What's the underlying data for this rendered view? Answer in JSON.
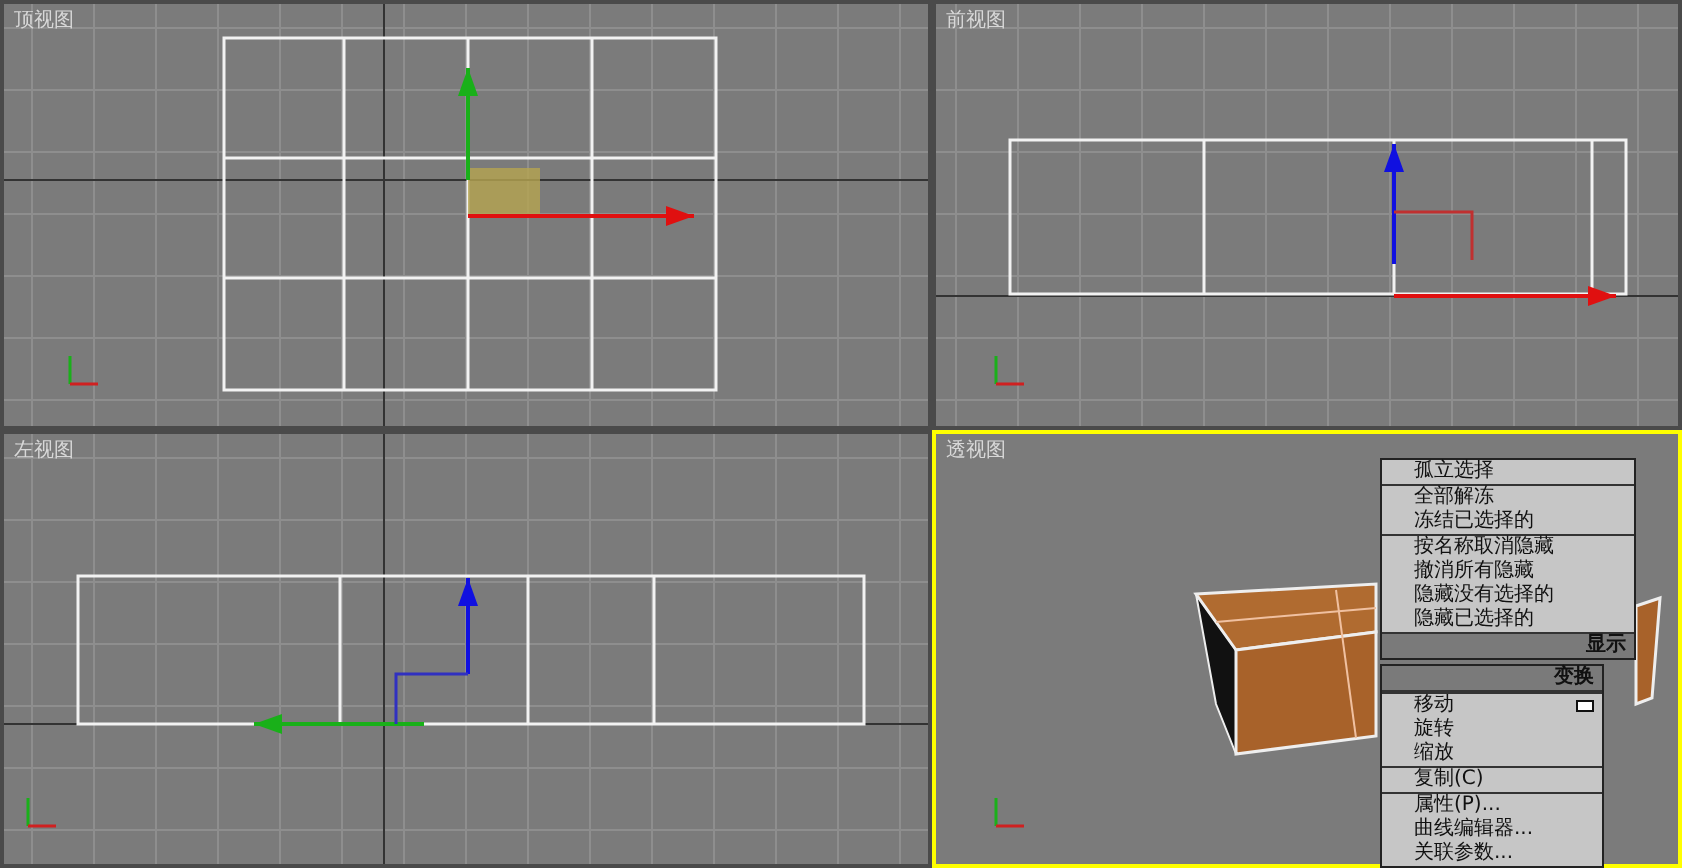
{
  "viewports": [
    {
      "label": "顶视图",
      "kind": "top",
      "active": false
    },
    {
      "label": "前视图",
      "kind": "front",
      "active": false
    },
    {
      "label": "左视图",
      "kind": "left",
      "active": false
    },
    {
      "label": "透视图",
      "kind": "perspective",
      "active": true
    }
  ],
  "quad_menu": {
    "display": {
      "title": "显示",
      "groups": [
        [
          "孤立选择"
        ],
        [
          "全部解冻",
          "冻结已选择的"
        ],
        [
          "按名称取消隐藏",
          "撤消所有隐藏",
          "隐藏没有选择的",
          "隐藏已选择的"
        ]
      ]
    },
    "transform": {
      "title": "变换",
      "groups": [
        [
          {
            "label": "移动",
            "options": true
          },
          {
            "label": "旋转",
            "options": false
          },
          {
            "label": "缩放",
            "options": false
          }
        ],
        [
          {
            "label": "复制(C)",
            "options": false
          }
        ],
        [
          {
            "label": "属性(P)...",
            "options": false
          },
          {
            "label": "曲线编辑器...",
            "options": false
          },
          {
            "label": "关联参数...",
            "options": false
          }
        ]
      ]
    }
  }
}
